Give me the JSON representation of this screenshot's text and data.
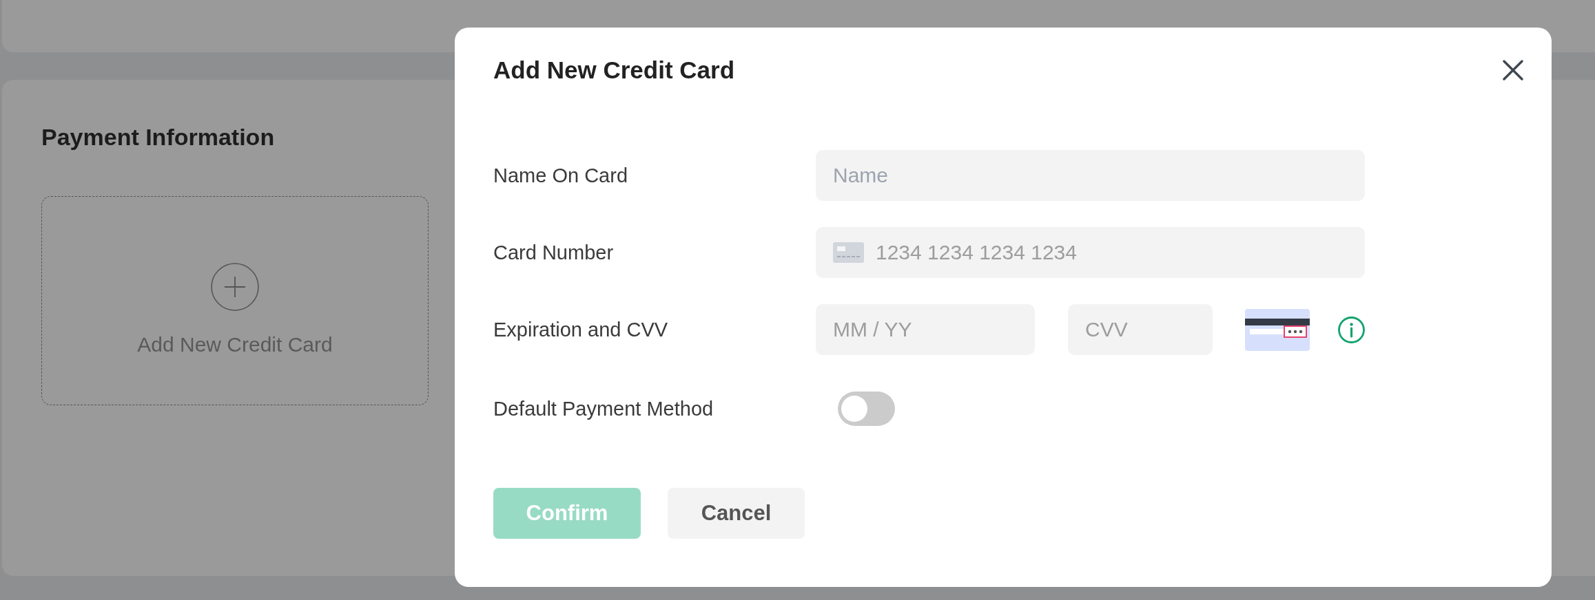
{
  "background": {
    "section_title": "Payment Information",
    "add_card_label": "Add New Credit Card"
  },
  "modal": {
    "title": "Add New Credit Card",
    "rows": [
      {
        "label": "Name On Card",
        "inputs": [
          {
            "kind": "text",
            "placeholder": "Name"
          }
        ]
      },
      {
        "label": "Card Number",
        "inputs": [
          {
            "kind": "card_number",
            "placeholder": "1234 1234 1234 1234"
          }
        ]
      },
      {
        "label": "Expiration and CVV",
        "inputs": [
          {
            "kind": "expiry",
            "placeholder": "MM / YY"
          },
          {
            "kind": "cvv",
            "placeholder": "CVV"
          }
        ]
      }
    ],
    "default_payment": {
      "label": "Default Payment Method",
      "on": false
    },
    "buttons": [
      {
        "label": "Confirm",
        "kind": "primary",
        "disabled": true
      },
      {
        "label": "Cancel",
        "kind": "secondary",
        "disabled": false
      }
    ]
  }
}
